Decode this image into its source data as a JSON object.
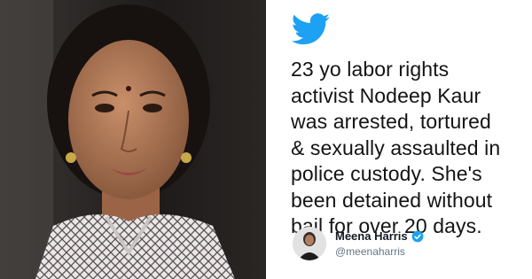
{
  "tweet": {
    "text": "23 yo labor rights\nactivist Nodeep Kaur\nwas arrested, tortured\n& sexually assaulted in\npolice custody. She's\nbeen detained without\nbail for over 20 days.",
    "author_name": "Meena Harris",
    "author_handle": "@meenaharris"
  },
  "colors": {
    "twitter_blue": "#1DA1F2",
    "text": "#141414",
    "handle": "#657786"
  },
  "icons": [
    "twitter-bird-icon",
    "verified-badge-icon"
  ]
}
